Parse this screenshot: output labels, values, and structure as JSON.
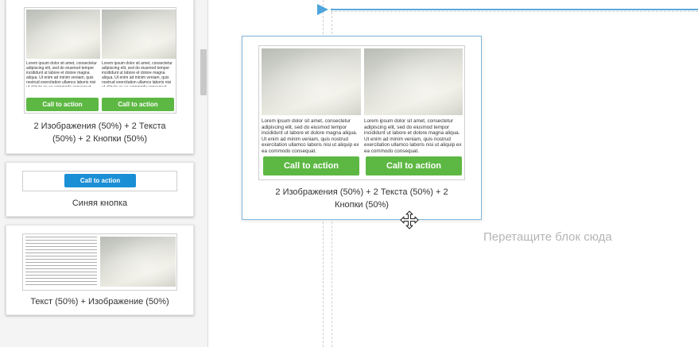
{
  "palette": {
    "cards": [
      {
        "caption_line1": "2 Изображения (50%) + 2 Текста",
        "caption_line2": "(50%) + 2 Кнопки (50%)",
        "columns": [
          {
            "text": "Lorem ipsum dolor sit amet, consectetur adipiscing elit, sed do eiusmod tempor incididunt ut labore et dolore magna aliqua. Ut enim ad minim veniam, quis nostrud exercitation ullamco laboris nisi ut aliquip ex ea commodo consequat.",
            "button": "Call to action"
          },
          {
            "text": "Lorem ipsum dolor sit amet, consectetur adipiscing elit, sed do eiusmod tempor incididunt ut labore et dolore magna aliqua. Ut enim ad minim veniam, quis nostrud exercitation ullamco laboris nisi ut aliquip ex ea commodo consequat.",
            "button": "Call to action"
          }
        ]
      },
      {
        "caption": "Синяя кнопка",
        "button": "Call to action"
      },
      {
        "caption": "Текст (50%) + Изображение (50%)"
      }
    ]
  },
  "dragged_block": {
    "caption": "2 Изображения (50%) + 2 Текста (50%) + 2 Кнопки (50%)",
    "columns": [
      {
        "text": "Lorem ipsum dolor sit amet, consectetur adipiscing elit, sed do eiusmod tempor incididunt ut labore et dolore magna aliqua. Ut enim ad minim veniam, quis nostrud exercitation ullamco laboris nisi ut aliquip ex ea commodo consequat.",
        "button": "Call to action"
      },
      {
        "text": "Lorem ipsum dolor sit amet, consectetur adipiscing elit, sed do eiusmod tempor incididunt ut labore et dolore magna aliqua. Ut enim ad minim veniam, quis nostrud exercitation ullamco laboris nisi ut aliquip ex ea commodo consequat.",
        "button": "Call to action"
      }
    ]
  },
  "canvas": {
    "drop_hint": "Перетащите блок сюда"
  },
  "colors": {
    "green_button": "#5db843",
    "blue_button": "#1a8fd6",
    "guide_line": "#5aa8d8"
  },
  "icons": [
    "move-cursor-icon",
    "insert-marker-icon"
  ]
}
